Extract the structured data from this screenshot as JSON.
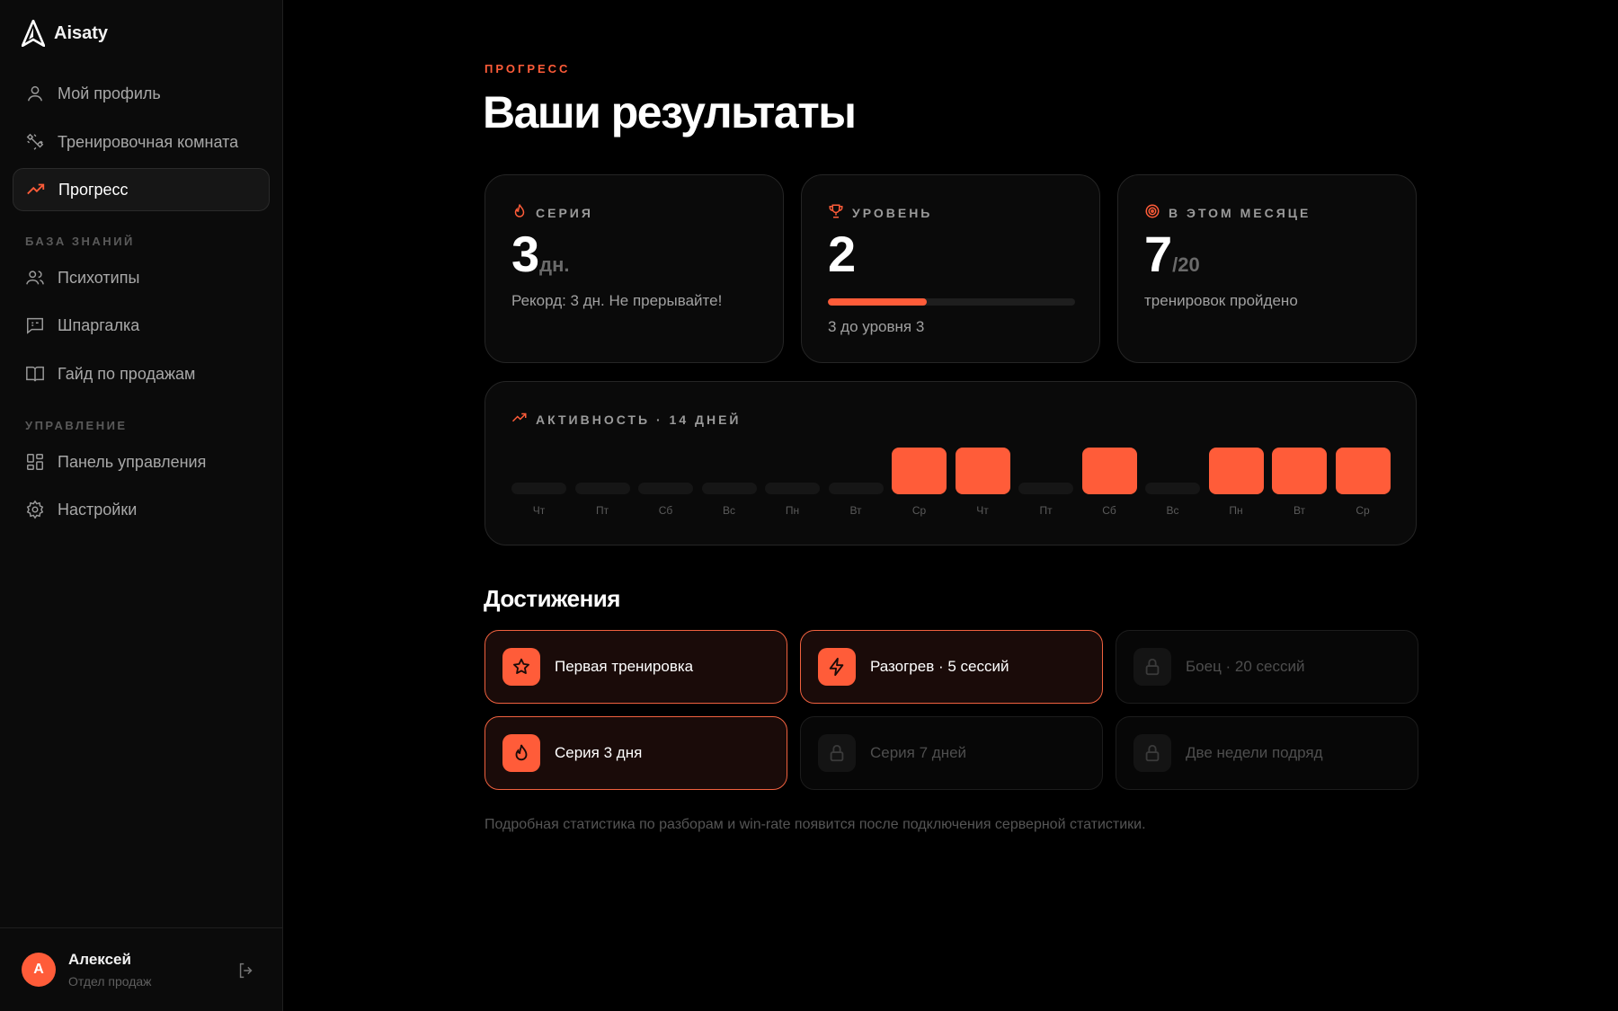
{
  "brand": {
    "name": "Aisaty"
  },
  "sidebar": {
    "nav": [
      {
        "label": "Мой профиль",
        "icon": "user-icon"
      },
      {
        "label": "Тренировочная комната",
        "icon": "dumbbell-icon"
      },
      {
        "label": "Прогресс",
        "icon": "trending-up-icon",
        "active": true
      }
    ],
    "knowledge_label": "БАЗА ЗНАНИЙ",
    "knowledge": [
      {
        "label": "Психотипы",
        "icon": "users-icon"
      },
      {
        "label": "Шпаргалка",
        "icon": "message-square-icon"
      },
      {
        "label": "Гайд по продажам",
        "icon": "book-open-icon"
      }
    ],
    "manage_label": "УПРАВЛЕНИЕ",
    "manage": [
      {
        "label": "Панель управления",
        "icon": "layout-grid-icon"
      },
      {
        "label": "Настройки",
        "icon": "gear-icon"
      }
    ],
    "user": {
      "initial": "А",
      "name": "Алексей",
      "role": "Отдел продаж"
    }
  },
  "header": {
    "eyebrow": "ПРОГРЕСС",
    "title": "Ваши результаты"
  },
  "stats": {
    "streak": {
      "label": "СЕРИЯ",
      "value": "3",
      "suffix": "дн.",
      "note": "Рекорд: 3 дн. Не прерывайте!"
    },
    "level": {
      "label": "УРОВЕНЬ",
      "value": "2",
      "progress": 0.4,
      "note": "3 до уровня 3"
    },
    "month": {
      "label": "В ЭТОМ МЕСЯЦЕ",
      "value": "7",
      "suffix": "/20",
      "note": "тренировок пройдено"
    }
  },
  "activity": {
    "label": "АКТИВНОСТЬ · 14 ДНЕЙ",
    "days": [
      "Чт",
      "Пт",
      "Сб",
      "Вс",
      "Пн",
      "Вт",
      "Ср",
      "Чт",
      "Пт",
      "Сб",
      "Вс",
      "Пн",
      "Вт",
      "Ср"
    ],
    "active": [
      0,
      0,
      0,
      0,
      0,
      0,
      1,
      1,
      0,
      1,
      0,
      1,
      1,
      1
    ]
  },
  "achievements": {
    "title": "Достижения",
    "items": [
      {
        "label": "Первая тренировка",
        "unlocked": true,
        "icon": "star-icon"
      },
      {
        "label": "Разогрев · 5 сессий",
        "unlocked": true,
        "icon": "bolt-icon"
      },
      {
        "label": "Боец · 20 сессий",
        "unlocked": false,
        "icon": "lock-icon"
      },
      {
        "label": "Серия 3 дня",
        "unlocked": true,
        "icon": "flame-icon"
      },
      {
        "label": "Серия 7 дней",
        "unlocked": false,
        "icon": "lock-icon"
      },
      {
        "label": "Две недели подряд",
        "unlocked": false,
        "icon": "lock-icon"
      }
    ]
  },
  "footnote": "Подробная статистика по разборам и win-rate появится после подключения серверной статистики.",
  "colors": {
    "accent": "#ff5c39",
    "background": "#000000",
    "sidebar": "#0b0b0b"
  }
}
